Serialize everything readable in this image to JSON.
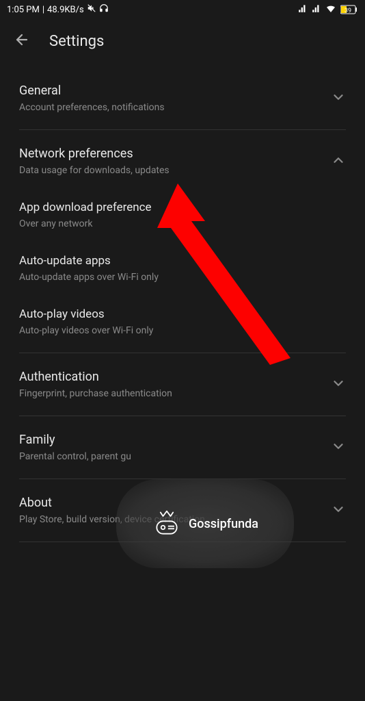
{
  "status_bar": {
    "time": "1:05 PM",
    "speed": "48.9KB/s",
    "battery": "39"
  },
  "header": {
    "title": "Settings"
  },
  "sections": {
    "general": {
      "title": "General",
      "sub": "Account preferences, notifications"
    },
    "network": {
      "title": "Network preferences",
      "sub": "Data usage for downloads,         updates",
      "items": {
        "download_pref": {
          "title": "App download preference",
          "sub": "Over any network"
        },
        "auto_update": {
          "title": "Auto-update apps",
          "sub": "Auto-update apps over Wi-Fi only"
        },
        "auto_play": {
          "title": "Auto-play videos",
          "sub": "Auto-play videos over Wi-Fi only"
        }
      }
    },
    "auth": {
      "title": "Authentication",
      "sub": "Fingerprint, purchase authentication"
    },
    "family": {
      "title": "Family",
      "sub": "Parental control, parent gu"
    },
    "about": {
      "title": "About",
      "sub": "Play Store, build version, device certification"
    }
  },
  "watermark": {
    "text": "Gossipfunda"
  }
}
